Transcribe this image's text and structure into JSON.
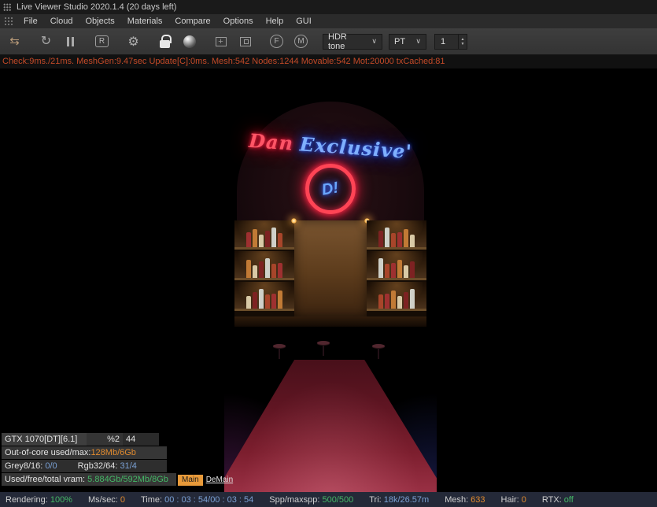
{
  "title_bar": {
    "title": "Live Viewer Studio 2020.1.4 (20 days left)"
  },
  "menu": {
    "items": [
      "File",
      "Cloud",
      "Objects",
      "Materials",
      "Compare",
      "Options",
      "Help",
      "GUI"
    ]
  },
  "toolbar": {
    "region_letter": "R",
    "focus_letter": "F",
    "material_letter": "M",
    "hdr_dropdown": "HDR tone",
    "kernel_dropdown": "PT",
    "passes_value": "1"
  },
  "status_line": "Check:9ms./21ms. MeshGen:9.47sec Update[C]:0ms. Mesh:542 Nodes:1244 Movable:542 Mot:20000 txCached:81",
  "render": {
    "neon_word1": "Dan",
    "neon_word2": "Exclusive'",
    "logo": "D!"
  },
  "hud": {
    "gpu_name": "GTX 1070[DT][6.1]",
    "gpu_load": "%2",
    "gpu_temp": "44",
    "ooc_label": "Out-of-core used/max:",
    "ooc_value": "128Mb/6Gb",
    "grey_label": "Grey8/16:",
    "grey_value": "0/0",
    "rgb_label": "Rgb32/64:",
    "rgb_value": "31/4",
    "vram_label": "Used/free/total vram:",
    "vram_value": "5.884Gb/592Mb/8Gb",
    "tabs": [
      {
        "label": "Main"
      },
      {
        "label": "DeMain"
      }
    ]
  },
  "status_bar": {
    "rendering_label": "Rendering:",
    "rendering_value": "100%",
    "mssec_label": "Ms/sec:",
    "mssec_value": "0",
    "time_label": "Time:",
    "time_value": "00 : 03 : 54/00 : 03 : 54",
    "spp_label": "Spp/maxspp:",
    "spp_value": "500/500",
    "tri_label": "Tri:",
    "tri_value": "18k/26.57m",
    "mesh_label": "Mesh:",
    "mesh_value": "633",
    "hair_label": "Hair:",
    "hair_value": "0",
    "rtx_label": "RTX:",
    "rtx_value": "off"
  },
  "colors": {
    "status_text": "#c44a28",
    "value_orange": "#e08a2e",
    "value_blue": "#7aa0d4",
    "value_green": "#44b866",
    "tab_active": "#e89a3a",
    "neon_red": "#ff5566",
    "neon_blue": "#7fb0ff"
  }
}
